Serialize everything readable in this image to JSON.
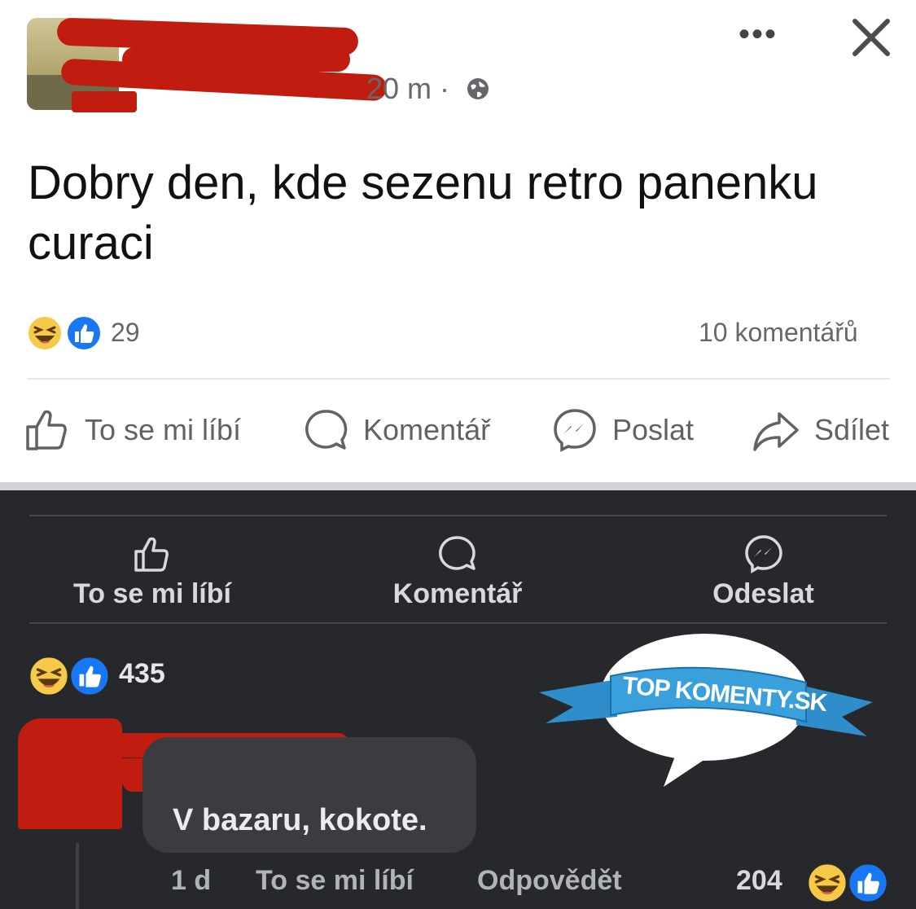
{
  "post": {
    "time": "20 m ·",
    "text": "Dobry den, kde sezenu retro panenku curaci",
    "reaction_count": "29",
    "comments_count": "10 komentářů",
    "actions": {
      "like": "To se mi líbí",
      "comment": "Komentář",
      "send": "Poslat",
      "share": "Sdílet"
    }
  },
  "dark": {
    "actions": {
      "like": "To se mi líbí",
      "comment": "Komentář",
      "send": "Odeslat"
    },
    "reaction_count": "435"
  },
  "comment": {
    "text": "V bazaru, kokote.",
    "age": "1 d",
    "like": "To se mi líbí",
    "reply": "Odpovědět",
    "reaction_count": "204"
  },
  "watermark": {
    "text": "TOP KOMENTY.SK"
  },
  "colors": {
    "like_blue": "#1877f2",
    "haha_yellow": "#f7c948",
    "redaction": "#c01d10"
  }
}
